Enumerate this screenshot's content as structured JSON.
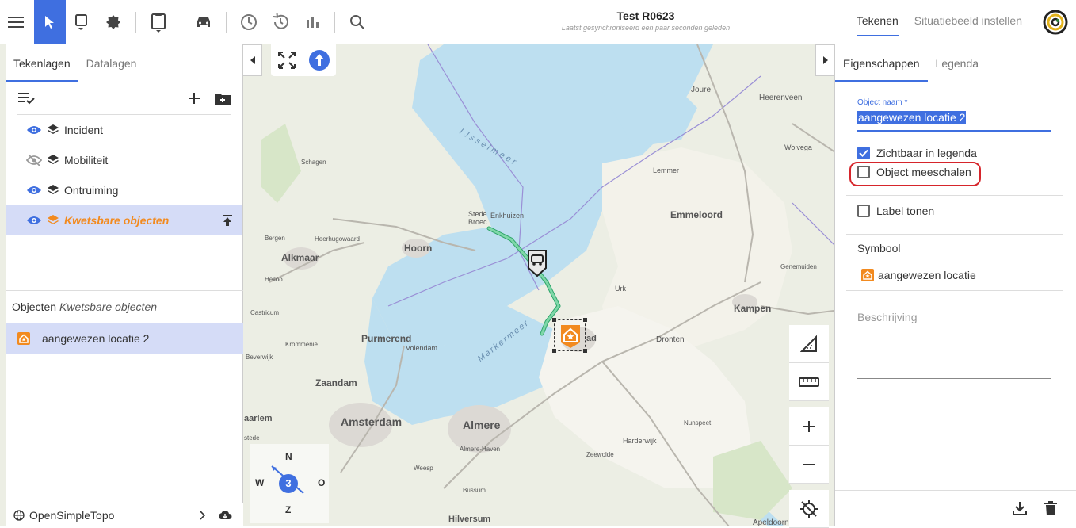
{
  "header": {
    "title": "Test R0623",
    "subtitle": "Laatst gesynchroniseerd een paar seconden geleden",
    "tabs": [
      {
        "label": "Tekenen",
        "active": true
      },
      {
        "label": "Situatiebeeld instellen",
        "active": false
      }
    ],
    "accent_color": "#3f6fe0"
  },
  "left_panel": {
    "tabs": [
      {
        "label": "Tekenlagen",
        "active": true
      },
      {
        "label": "Datalagen",
        "active": false
      }
    ],
    "layers": [
      {
        "label": "Incident",
        "visible": true,
        "selected": false
      },
      {
        "label": "Mobiliteit",
        "visible": false,
        "selected": false
      },
      {
        "label": "Ontruiming",
        "visible": true,
        "selected": false
      },
      {
        "label": "Kwetsbare objecten",
        "visible": true,
        "selected": true
      }
    ],
    "objects_label": "Objecten",
    "objects_layer": "Kwetsbare objecten",
    "objects": [
      {
        "label": "aangewezen locatie 2",
        "icon": "house-star-icon"
      }
    ],
    "basemap": "OpenSimpleTopo"
  },
  "compass": {
    "n": "N",
    "o": "O",
    "z": "Z",
    "w": "W",
    "badge": "3"
  },
  "map_labels": {
    "ijsselmeer": "IJsselmeer",
    "markermeer": "Markermeer",
    "amsterdam": "Amsterdam",
    "almere": "Almere",
    "hoorn": "Hoorn",
    "alkmaar": "Alkmaar",
    "purmerend": "Purmerend",
    "zaandam": "Zaandam",
    "emmeloord": "Emmeloord",
    "kampen": "Kampen",
    "dronten": "Dronten",
    "enkhuizen": "Enkhuizen",
    "stede_broec": "Stede Broec",
    "volendam": "Volendam",
    "lemmer": "Lemmer",
    "joure": "Joure",
    "heerenveen": "Heerenveen",
    "wolvega": "Wolvega",
    "urk": "Urk",
    "genemuiden": "Genemuiden",
    "harderwijk": "Harderwijk",
    "zeewolde": "Zeewolde",
    "nunspeet": "Nunspeet",
    "hilversum": "Hilversum",
    "schagen": "Schagen",
    "bergen": "Bergen",
    "heerhugowaard": "Heerhugowaard",
    "heiloo": "Heiloo",
    "castricum": "Castricum",
    "krommenie": "Krommenie",
    "beverwijk": "Beverwijk",
    "haarlem": "aarlem",
    "stede": "stede",
    "almere_haven": "Almere-Haven",
    "weesp": "Weesp",
    "bussum": "Bussum",
    "apeldoorn": "Apeldoorn",
    "lelystad": "Lelystad"
  },
  "right_panel": {
    "tabs": [
      {
        "label": "Eigenschappen",
        "active": true
      },
      {
        "label": "Legenda",
        "active": false
      }
    ],
    "name_label": "Object naam *",
    "name_value": "aangewezen locatie 2",
    "checkbox_legend": {
      "label": "Zichtbaar in legenda",
      "checked": true
    },
    "checkbox_scale": {
      "label": "Object meeschalen",
      "checked": false
    },
    "checkbox_label": {
      "label": "Label tonen",
      "checked": false
    },
    "symbol_title": "Symbool",
    "symbol_value": "aangewezen locatie",
    "description_placeholder": "Beschrijving"
  }
}
